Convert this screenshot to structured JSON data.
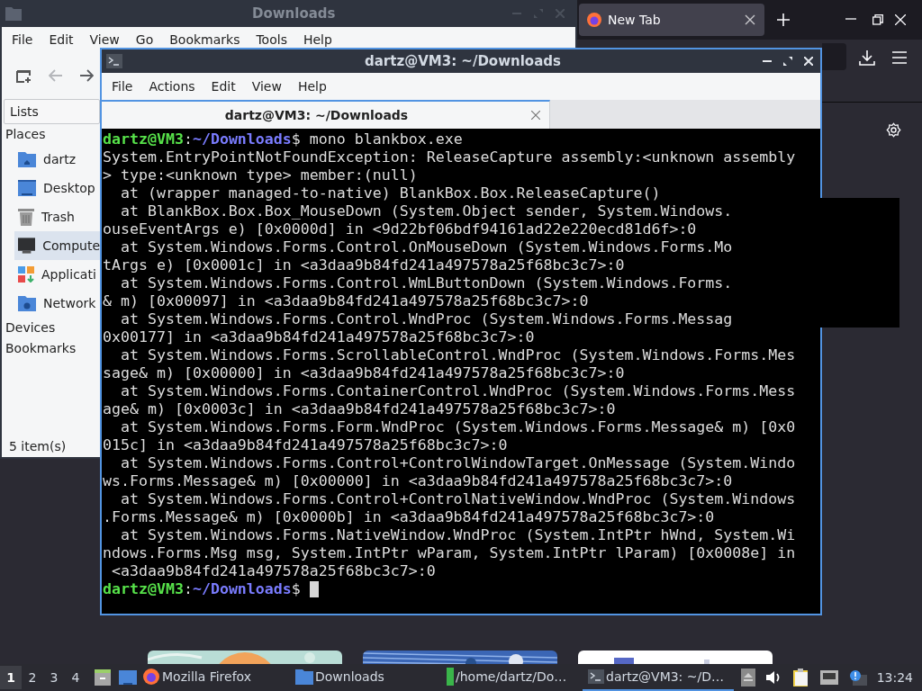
{
  "browser": {
    "tabs": [
      {
        "label": "New Tab",
        "selected": true
      }
    ]
  },
  "file_manager": {
    "title": "Downloads",
    "menu": [
      "File",
      "Edit",
      "View",
      "Go",
      "Bookmarks",
      "Tools",
      "Help"
    ],
    "side_pane_mode": "Lists",
    "sections": [
      {
        "title": "Places",
        "items": [
          {
            "kind": "home",
            "label": "dartz",
            "selected": false
          },
          {
            "kind": "desktop",
            "label": "Desktop",
            "selected": false
          },
          {
            "kind": "trash",
            "label": "Trash",
            "selected": false
          },
          {
            "kind": "computer",
            "label": "Compute",
            "selected": true
          },
          {
            "kind": "apps",
            "label": "Applicati",
            "selected": false
          },
          {
            "kind": "network",
            "label": "Network",
            "selected": false
          }
        ]
      },
      {
        "title": "Devices"
      },
      {
        "title": "Bookmarks"
      }
    ],
    "status": "5 item(s)"
  },
  "terminal": {
    "title": "dartz@VM3: ~/Downloads",
    "menu": [
      "File",
      "Actions",
      "Edit",
      "View",
      "Help"
    ],
    "tabs": [
      {
        "label": "dartz@VM3: ~/Downloads",
        "selected": true
      }
    ],
    "lines": [
      {
        "kind": "prompt",
        "user": "dartz@VM3",
        "separator": ":",
        "path": "~/Downloads",
        "symbol": "$",
        "command": "mono blankbox.exe"
      },
      {
        "kind": "output",
        "text": "System.EntryPointNotFoundException: ReleaseCapture assembly:<unknown assembly"
      },
      {
        "kind": "output",
        "text": "> type:<unknown type> member:(null)"
      },
      {
        "kind": "output",
        "text": "  at (wrapper managed-to-native) BlankBox.Box.ReleaseCapture()"
      },
      {
        "kind": "output",
        "text": "  at BlankBox.Box.Box_MouseDown (System.Object sender, System.Windows."
      },
      {
        "kind": "output",
        "text": "ouseEventArgs e) [0x0000d] in <9d22bf06bdf94161ad22e220ecd81d6f>:0"
      },
      {
        "kind": "output",
        "text": "  at System.Windows.Forms.Control.OnMouseDown (System.Windows.Forms.Mo"
      },
      {
        "kind": "output",
        "text": "tArgs e) [0x0001c] in <a3daa9b84fd241a497578a25f68bc3c7>:0"
      },
      {
        "kind": "output",
        "text": "  at System.Windows.Forms.Control.WmLButtonDown (System.Windows.Forms."
      },
      {
        "kind": "output",
        "text": "& m) [0x00097] in <a3daa9b84fd241a497578a25f68bc3c7>:0"
      },
      {
        "kind": "output",
        "text": "  at System.Windows.Forms.Control.WndProc (System.Windows.Forms.Messag"
      },
      {
        "kind": "output",
        "text": "0x00177] in <a3daa9b84fd241a497578a25f68bc3c7>:0"
      },
      {
        "kind": "output",
        "text": "  at System.Windows.Forms.ScrollableControl.WndProc (System.Windows.Forms.Mes"
      },
      {
        "kind": "output",
        "text": "sage& m) [0x00000] in <a3daa9b84fd241a497578a25f68bc3c7>:0"
      },
      {
        "kind": "output",
        "text": "  at System.Windows.Forms.ContainerControl.WndProc (System.Windows.Forms.Mess"
      },
      {
        "kind": "output",
        "text": "age& m) [0x0003c] in <a3daa9b84fd241a497578a25f68bc3c7>:0"
      },
      {
        "kind": "output",
        "text": "  at System.Windows.Forms.Form.WndProc (System.Windows.Forms.Message& m) [0x0"
      },
      {
        "kind": "output",
        "text": "015c] in <a3daa9b84fd241a497578a25f68bc3c7>:0"
      },
      {
        "kind": "output",
        "text": "  at System.Windows.Forms.Control+ControlWindowTarget.OnMessage (System.Windo"
      },
      {
        "kind": "output",
        "text": "ws.Forms.Message& m) [0x00000] in <a3daa9b84fd241a497578a25f68bc3c7>:0"
      },
      {
        "kind": "output",
        "text": "  at System.Windows.Forms.Control+ControlNativeWindow.WndProc (System.Windows"
      },
      {
        "kind": "output",
        "text": ".Forms.Message& m) [0x0000b] in <a3daa9b84fd241a497578a25f68bc3c7>:0"
      },
      {
        "kind": "output",
        "text": "  at System.Windows.Forms.NativeWindow.WndProc (System.IntPtr hWnd, System.Wi"
      },
      {
        "kind": "output",
        "text": "ndows.Forms.Msg msg, System.IntPtr wParam, System.IntPtr lParam) [0x0008e] in"
      },
      {
        "kind": "output",
        "text": " <a3daa9b84fd241a497578a25f68bc3c7>:0"
      },
      {
        "kind": "prompt",
        "user": "dartz@VM3",
        "separator": ":",
        "path": "~/Downloads",
        "symbol": "$",
        "cursor": true
      }
    ]
  },
  "taskbar": {
    "workspaces": [
      {
        "label": "1",
        "selected": true
      },
      {
        "label": "2",
        "selected": false
      },
      {
        "label": "3",
        "selected": false
      },
      {
        "label": "4",
        "selected": false
      }
    ],
    "tasks": [
      {
        "kind": "firefox",
        "label": "Mozilla Firefox",
        "selected": false
      },
      {
        "kind": "folder",
        "label": "Downloads",
        "selected": false
      },
      {
        "kind": "file",
        "label": "/home/dartz/Do…",
        "selected": false
      },
      {
        "kind": "terminal",
        "label": "dartz@VM3: ~/D…",
        "selected": true
      }
    ],
    "clock": "13:24"
  }
}
